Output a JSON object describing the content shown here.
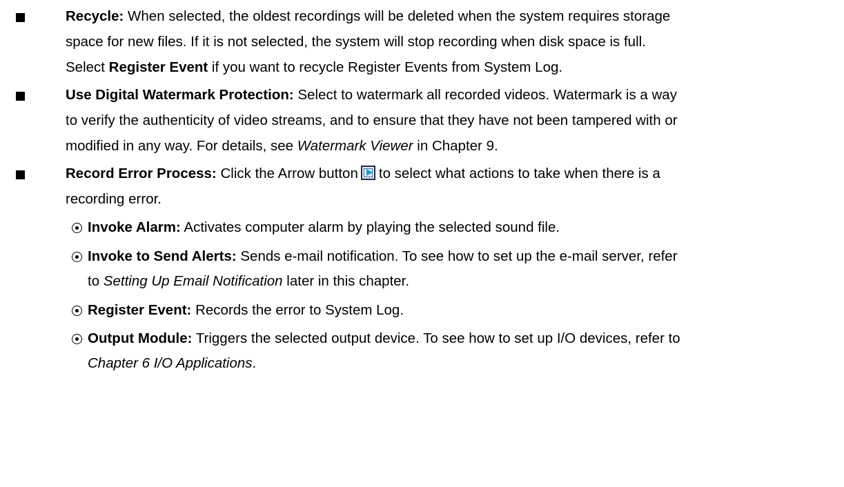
{
  "items": [
    {
      "title": "Recycle:",
      "line1": "When selected, the oldest recordings will be deleted when the system requires storage",
      "line2": "space for new files. If it is not selected, the system will stop recording when disk space is full.",
      "line3_a": "Select ",
      "line3_b": "Register Event",
      "line3_c": " if you want to recycle Register Events from System Log."
    },
    {
      "title": "Use Digital Watermark Protection:",
      "line1": "Select to watermark all recorded videos. Watermark is a way",
      "line2": "to verify the authenticity of video streams, and to ensure that they have not been tampered with or",
      "line3_a": "modified in any way. For details, see ",
      "line3_b": "Watermark Viewer",
      "line3_c": " in Chapter 9."
    },
    {
      "title": "Record Error Process:",
      "line1_a": "Click the Arrow button",
      "line1_b": "to select what actions to take when there is a",
      "line2": "recording error.",
      "arrow_icon": "arrow-button-icon"
    }
  ],
  "subitems": [
    {
      "title": "Invoke Alarm:",
      "line1": "Activates computer alarm by playing the selected sound file."
    },
    {
      "title": "Invoke to Send Alerts:",
      "line1": "Sends e-mail notification. To see how to set up the e-mail server, refer",
      "line2_a": "to ",
      "line2_b": "Setting Up Email Notification",
      "line2_c": " later in this chapter."
    },
    {
      "title": "Register Event:",
      "line1": "Records the error to System Log."
    },
    {
      "title": "Output Module:",
      "line1": "Triggers the selected output device. To see how to set up I/O devices, refer to",
      "line2_a": "Chapter 6 I/O Applications",
      "line2_b": "."
    }
  ]
}
